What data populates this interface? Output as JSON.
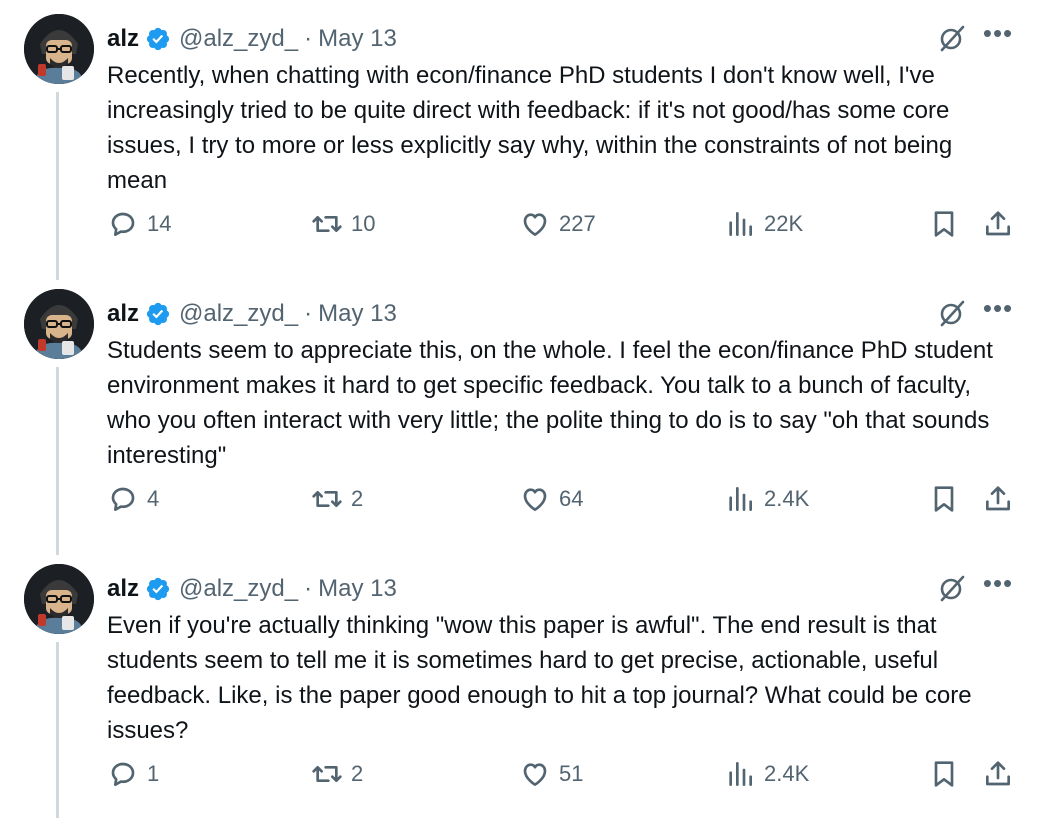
{
  "colors": {
    "verified": "#1d9bf0",
    "muted": "#536471",
    "text": "#0f1419",
    "thread_line": "#cfd9de"
  },
  "tweets": [
    {
      "name": "alz",
      "handle": "@alz_zyd_",
      "separator": "·",
      "date": "May 13",
      "text": "Recently, when chatting with econ/finance PhD students I don't know well, I've increasingly tried to be quite direct with feedback: if it's not good/has some core issues, I try to more or less explicitly say why, within the constraints of not being mean",
      "replies": "14",
      "reposts": "10",
      "likes": "227",
      "views": "22K"
    },
    {
      "name": "alz",
      "handle": "@alz_zyd_",
      "separator": "·",
      "date": "May 13",
      "text": "Students seem to appreciate this, on the whole. I feel the econ/finance PhD student environment makes it hard to get specific feedback. You talk to a bunch of faculty, who you often interact with very little; the polite thing to do is to say \"oh that sounds interesting\"",
      "replies": "4",
      "reposts": "2",
      "likes": "64",
      "views": "2.4K"
    },
    {
      "name": "alz",
      "handle": "@alz_zyd_",
      "separator": "·",
      "date": "May 13",
      "text": "Even if you're actually thinking \"wow this paper is awful\". The end result is that students seem to tell me it is sometimes hard to get precise, actionable, useful feedback. Like, is the paper good enough to hit a top journal? What could be core issues?",
      "replies": "1",
      "reposts": "2",
      "likes": "51",
      "views": "2.4K"
    }
  ]
}
